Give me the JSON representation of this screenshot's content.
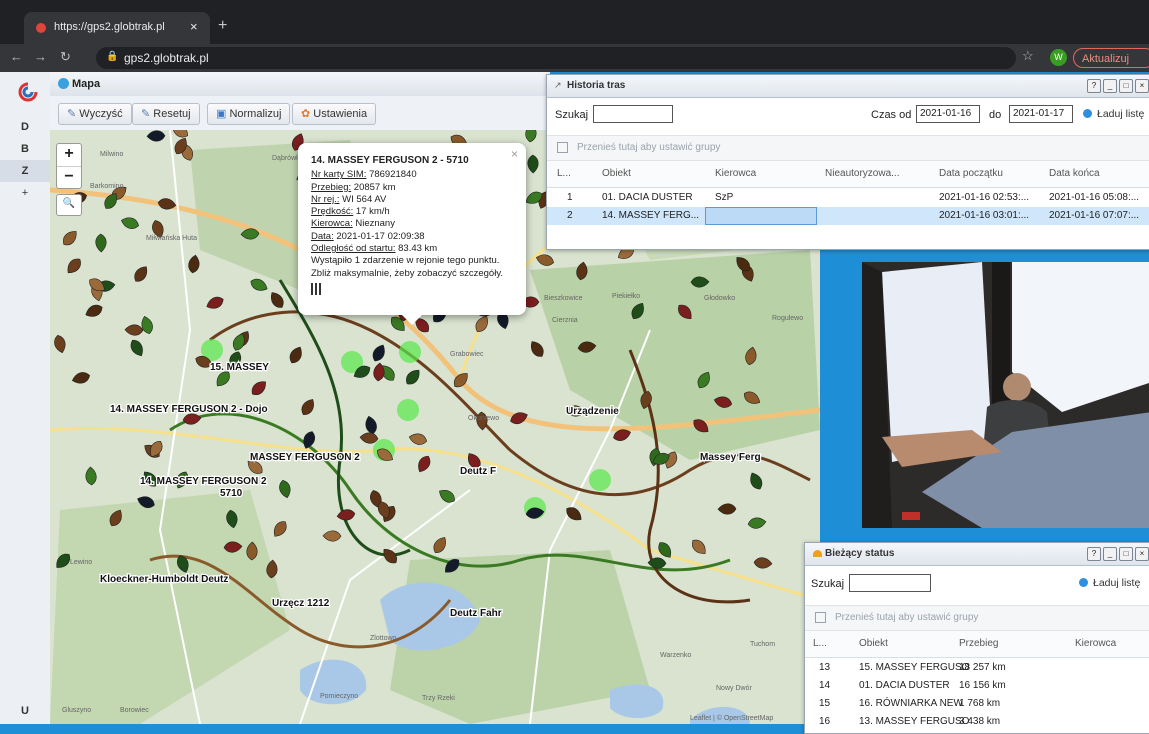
{
  "browser": {
    "tab_title": "https://gps2.globtrak.pl",
    "tab_close": "×",
    "new_tab": "+",
    "url": "gps2.globtrak.pl",
    "profile_initial": "W",
    "update_label": "Aktualizuj"
  },
  "rail": {
    "items": [
      "D",
      "B",
      "Z",
      "+",
      "U"
    ]
  },
  "map_panel": {
    "title": "Mapa",
    "toolbar": {
      "clear": "Wyczyść",
      "reset": "Resetuj",
      "normalize": "Normalizuj",
      "settings": "Ustawienia"
    },
    "zoom_in": "+",
    "zoom_out": "−",
    "place_labels": [
      "Dąbrówka",
      "Barkomino",
      "Milwino",
      "Miłwiańska Huta",
      "15. MASSEY",
      "14. MASSEY FERGUSON 2 - Dojo",
      "14. MASSEY FERGUSON 2",
      "5710",
      "MASSEY FERGUSON 2",
      "Deutz F",
      "Okuniewo",
      "Urządzenie",
      "Massey Ferg",
      "Bieszkowice",
      "Piekiełko",
      "Głodowko",
      "Rogulewo",
      "Cierznia",
      "Grabowiec",
      "Lewino",
      "Kloeckner-Humboldt Deutz",
      "Urzęcz 1212",
      "Deutz Fahr",
      "Warzenko",
      "Tuchom",
      "Zlottowo",
      "Gluszyno",
      "Borowiec",
      "Pomieczyno",
      "Trzy Rzeki",
      "Nowy Dwór",
      "Leaflet | © OpenStreetMap"
    ]
  },
  "popup": {
    "title": "14. MASSEY FERGUSON 2 - 5710",
    "fields": [
      {
        "label": "Nr karty SIM:",
        "value": "786921840"
      },
      {
        "label": "Przebieg:",
        "value": "20857 km"
      },
      {
        "label": "Nr rej.:",
        "value": "WI 564 AV"
      },
      {
        "label": "Prędkość:",
        "value": "17 km/h"
      },
      {
        "label": "Kierowca:",
        "value": "Nieznany"
      },
      {
        "label": "Data:",
        "value": "2021-01-17 02:09:38"
      },
      {
        "label": "Odległość od startu:",
        "value": "83.43 km"
      }
    ],
    "note1": "Wystąpiło 1 zdarzenie w rejonie tego punktu.",
    "note2": "Zbliż maksymalnie, żeby zobaczyć szczegóły.",
    "close": "×"
  },
  "history": {
    "title": "Historia tras",
    "search_label": "Szukaj",
    "search_value": "",
    "time_from_label": "Czas od",
    "time_from": "2021-01-16",
    "time_to_label": "do",
    "time_to": "2021-01-17",
    "load_label": "Ładuj listę",
    "group_hint": "Przenieś tutaj aby ustawić grupy",
    "columns": [
      "L...",
      "Obiekt",
      "Kierowca",
      "Nieautoryzowa...",
      "Data początku",
      "Data końca"
    ],
    "rows": [
      {
        "n": "1",
        "obj": "01. DACIA DUSTER",
        "driver": "SzP",
        "unauth": "",
        "start": "2021-01-16 02:53:...",
        "end": "2021-01-16 05:08:..."
      },
      {
        "n": "2",
        "obj": "14. MASSEY FERG...",
        "driver": "",
        "unauth": "",
        "start": "2021-01-16 03:01:...",
        "end": "2021-01-16 07:07:..."
      }
    ]
  },
  "status": {
    "title": "Bieżący status",
    "search_label": "Szukaj",
    "search_value": "",
    "load_label": "Ładuj listę",
    "group_hint": "Przenieś tutaj aby ustawić grupy",
    "columns": [
      "L...",
      "Obiekt",
      "Przebieg",
      "Kierowca"
    ],
    "rows": [
      {
        "n": "13",
        "obj": "15. MASSEY FERGUSO",
        "mileage": "18 257 km"
      },
      {
        "n": "14",
        "obj": "01. DACIA DUSTER",
        "mileage": "16 156 km"
      },
      {
        "n": "15",
        "obj": "16. RÓWNIARKA NEW",
        "mileage": "1 768 km"
      },
      {
        "n": "16",
        "obj": "13. MASSEY FERGUSO",
        "mileage": "3 438 km"
      }
    ]
  },
  "colors": {
    "desktop": "#1e8fd6",
    "selection": "#cfe6fb",
    "accent": "#2e8fe0"
  }
}
